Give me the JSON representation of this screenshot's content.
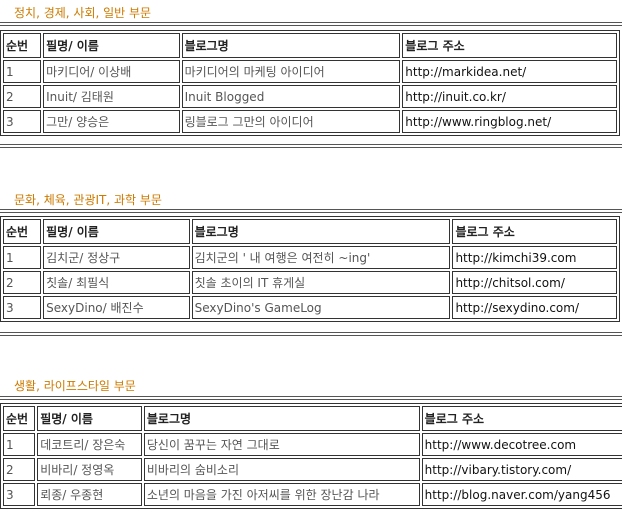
{
  "columns": {
    "no": "순번",
    "name": "필명/ 이름",
    "blog": "블로그명",
    "addr": "블로그 주소"
  },
  "sections": [
    {
      "title": "정치, 경제, 사회, 일반 부문",
      "rows": [
        {
          "no": "1",
          "name": "마키디어/ 이상배",
          "blog": "마키디어의 마케팅 아이디어",
          "url": "http://markidea.net/"
        },
        {
          "no": "2",
          "name": "Inuit/ 김태원",
          "blog": "Inuit Blogged",
          "url": "http://inuit.co.kr/"
        },
        {
          "no": "3",
          "name": "그만/ 양승은",
          "blog": "링블로그 그만의 아이디어",
          "url": "http://www.ringblog.net/"
        }
      ]
    },
    {
      "title": "문화, 체육, 관광IT, 과학 부문",
      "rows": [
        {
          "no": "1",
          "name": "김치군/ 정상구",
          "blog": "김치군의 ' 내 여행은 여전히 ~ing'",
          "url": "http://kimchi39.com"
        },
        {
          "no": "2",
          "name": "칫솔/ 최필식",
          "blog": "칫솔 초이의 IT 휴게실",
          "url": "http://chitsol.com/"
        },
        {
          "no": "3",
          "name": "SexyDino/ 배진수",
          "blog": "SexyDino's GameLog",
          "url": "http://sexydino.com/"
        }
      ]
    },
    {
      "title": "생활, 라이프스타일 부문",
      "rows": [
        {
          "no": "1",
          "name": "데코트리/ 장은숙",
          "blog": "당신이 꿈꾸는 자연 그대로",
          "url": "http://www.decotree.com"
        },
        {
          "no": "2",
          "name": "비바리/ 정영옥",
          "blog": "비바리의 숨비소리",
          "url": "http://vibary.tistory.com/"
        },
        {
          "no": "3",
          "name": "뢰종/ 우종현",
          "blog": "소년의 마음을 가진 아저씨를 위한 장난감 나라",
          "url": "http://blog.naver.com/yang456"
        }
      ]
    }
  ]
}
